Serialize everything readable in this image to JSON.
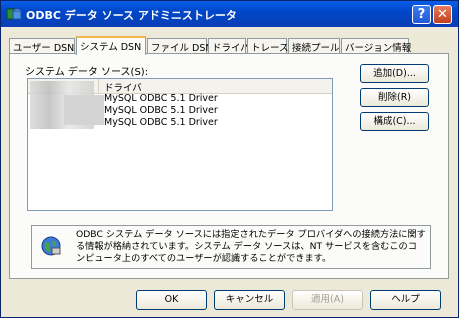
{
  "window": {
    "title": "ODBC データ ソース アドミニストレータ",
    "help": "?",
    "close": "✕"
  },
  "tabs": [
    {
      "label": "ユーザー DSN"
    },
    {
      "label": "システム DSN"
    },
    {
      "label": "ファイル DSN"
    },
    {
      "label": "ドライバ"
    },
    {
      "label": "トレース"
    },
    {
      "label": "接続プール"
    },
    {
      "label": "バージョン情報"
    }
  ],
  "list": {
    "label": "システム データ ソース(S):",
    "column_driver": "ドライバ",
    "rows": [
      {
        "driver": "MySQL ODBC 5.1 Driver"
      },
      {
        "driver": "MySQL ODBC 5.1 Driver"
      },
      {
        "driver": "MySQL ODBC 5.1 Driver"
      }
    ]
  },
  "buttons": {
    "add": "追加(D)...",
    "remove": "削除(R)",
    "configure": "構成(C)..."
  },
  "info": "ODBC システム データ ソースには指定されたデータ プロバイダへの接続方法に関する情報が格納されています。システム データ ソースは、NT サービスを含むこのコンピュータ上のすべてのユーザーが認識することができます。",
  "footer": {
    "ok": "OK",
    "cancel": "キャンセル",
    "apply": "適用(A)",
    "help": "ヘルプ"
  }
}
